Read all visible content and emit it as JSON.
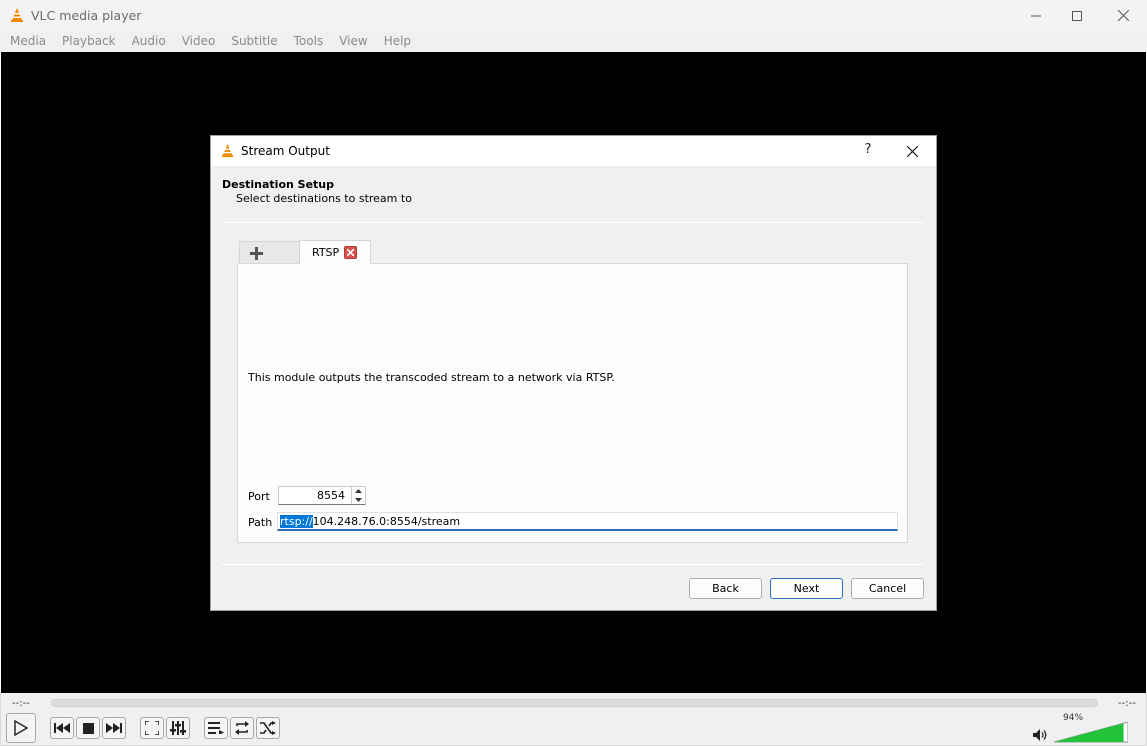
{
  "window": {
    "title": "VLC media player"
  },
  "menu": [
    "Media",
    "Playback",
    "Audio",
    "Video",
    "Subtitle",
    "Tools",
    "View",
    "Help"
  ],
  "dialog": {
    "title": "Stream Output",
    "help_label": "?",
    "heading": "Destination Setup",
    "subheading": "Select destinations to stream to",
    "tab_label": "RTSP",
    "description": "This module outputs the transcoded stream to a network via RTSP.",
    "port_label": "Port",
    "port_value": "8554",
    "path_label": "Path",
    "path_selected": "rtsp://",
    "path_rest": "104.248.76.0:8554/stream",
    "back_label": "Back",
    "next_label": "Next",
    "cancel_label": "Cancel"
  },
  "player": {
    "elapsed": "--:--",
    "remaining": "--:--",
    "volume_text": "94%",
    "volume_level": 0.94,
    "seek_progress": 0
  },
  "colors": {
    "accent": "#0078d7",
    "volume_fill": "#22c33a",
    "vlc_orange": "#f18a00"
  }
}
